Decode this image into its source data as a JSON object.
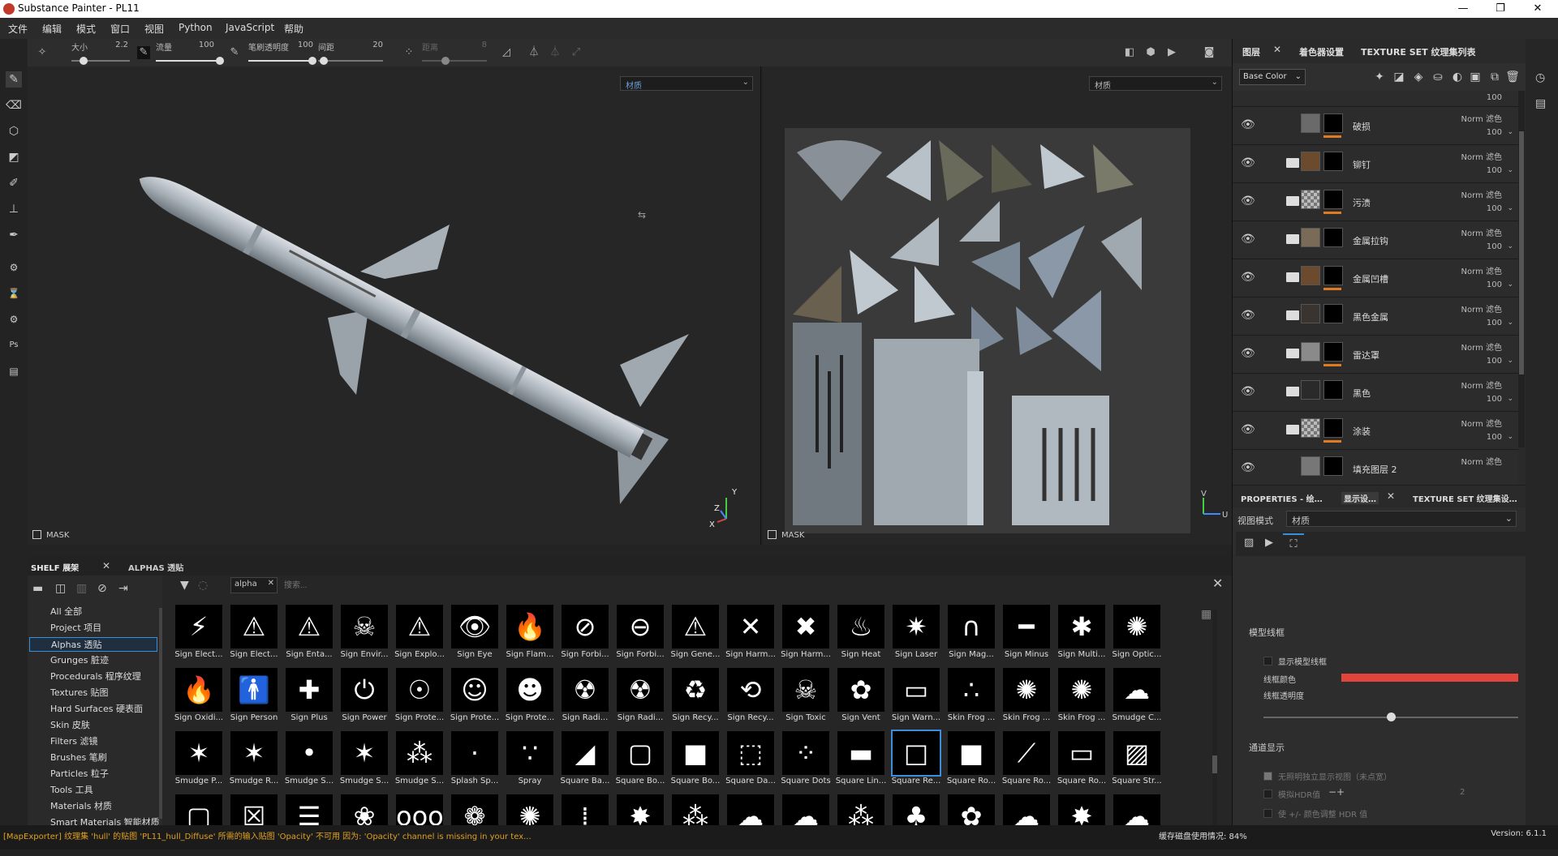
{
  "window": {
    "title": "Substance Painter - PL11",
    "minimize": "—",
    "maximize": "❐",
    "close": "✕"
  },
  "menu": [
    "文件",
    "编辑",
    "模式",
    "窗口",
    "视图",
    "Python",
    "JavaScript",
    "帮助"
  ],
  "toolbar": {
    "size": {
      "label": "大小",
      "value": "2.2"
    },
    "flow": {
      "label": "流量",
      "value": "100"
    },
    "stroke_opacity": {
      "label": "笔刷透明度",
      "value": "100"
    },
    "spacing": {
      "label": "间距",
      "value": "20"
    },
    "jitter": {
      "label": "距离",
      "value": "8"
    }
  },
  "viewport": {
    "left_select": "材质",
    "right_select": "材质",
    "mask_label": "MASK",
    "axes": {
      "y": "Y",
      "z": "Z",
      "x": "X",
      "u": "U",
      "v": "V"
    }
  },
  "layers_panel": {
    "tabs": [
      "图层",
      "着色器设置",
      "TEXTURE SET 纹理集列表"
    ],
    "channel": "Base Color",
    "layers": [
      {
        "name": "破损",
        "blend": "Norm 滤色",
        "opacity": "100",
        "thumb": "#6a6a6a",
        "has_folder": false
      },
      {
        "name": "铆钉",
        "blend": "Norm 滤色",
        "opacity": "100",
        "thumb": "#6b4a2e",
        "has_folder": true
      },
      {
        "name": "污渍",
        "blend": "Norm 滤色",
        "opacity": "100",
        "thumb": "checker",
        "has_folder": true
      },
      {
        "name": "金属拉钩",
        "blend": "Norm 滤色",
        "opacity": "100",
        "thumb": "#7a6a58",
        "has_folder": true
      },
      {
        "name": "金属凹槽",
        "blend": "Norm 滤色",
        "opacity": "100",
        "thumb": "#6b4a2e",
        "has_folder": true
      },
      {
        "name": "黑色金属",
        "blend": "Norm 滤色",
        "opacity": "100",
        "thumb": "#3a3430",
        "has_folder": true
      },
      {
        "name": "雷达罩",
        "blend": "Norm 滤色",
        "opacity": "100",
        "thumb": "#8a8a8a",
        "has_folder": true
      },
      {
        "name": "黑色",
        "blend": "Norm 滤色",
        "opacity": "100",
        "thumb": "#2a2a2a",
        "has_folder": true
      },
      {
        "name": "涂装",
        "blend": "Norm 滤色",
        "opacity": "100",
        "thumb": "checker",
        "has_folder": true
      },
      {
        "name": "填充图层 2",
        "blend": "Norm 滤色",
        "opacity": "",
        "thumb": "#777777",
        "has_folder": false
      }
    ]
  },
  "properties": {
    "tabs": [
      "PROPERTIES - 绘…",
      "显示设…",
      "TEXTURE SET 纹理集设…"
    ],
    "view_mode_label": "视图模式",
    "view_mode_value": "材质",
    "wireframe_section": "模型线框",
    "show_wireframe": "显示模型线框",
    "wire_color_label": "线框颜色",
    "wire_color": "#e0443a",
    "wire_opacity_label": "线框透明度",
    "wire_opacity": 0.5,
    "channel_section": "通道显示",
    "isolate": "无照明独立显示视图（未点宽）",
    "hdr_label": "模拟HDR值",
    "hdr_value": "2",
    "hdr_adjust": "使 +/- 颜色调整 HDR 值"
  },
  "shelf": {
    "tabs": [
      "SHELF 展架",
      "ALPHAS 透贴"
    ],
    "filter_tag": "alpha",
    "search_placeholder": "搜索...",
    "categories": [
      "All 全部",
      "Project 项目",
      "Alphas 透贴",
      "Grunges 脏迹",
      "Procedurals 程序纹理",
      "Textures 贴图",
      "Hard Surfaces 硬表面",
      "Skin 皮肤",
      "Filters 滤镜",
      "Brushes 笔刷",
      "Particles 粒子",
      "Tools 工具",
      "Materials 材质",
      "Smart Materials 智能材质"
    ],
    "selected_category": "Alphas 透贴",
    "alphas": [
      {
        "label": "Sign Elect...",
        "glyph": "⚡"
      },
      {
        "label": "Sign Elect...",
        "glyph": "⚠"
      },
      {
        "label": "Sign Enta...",
        "glyph": "⚠"
      },
      {
        "label": "Sign Envir...",
        "glyph": "☠"
      },
      {
        "label": "Sign Explo...",
        "glyph": "⚠"
      },
      {
        "label": "Sign Eye",
        "glyph": "👁"
      },
      {
        "label": "Sign Flam...",
        "glyph": "🔥"
      },
      {
        "label": "Sign Forbi...",
        "glyph": "⊘"
      },
      {
        "label": "Sign Forbi...",
        "glyph": "⊖"
      },
      {
        "label": "Sign Gene...",
        "glyph": "⚠"
      },
      {
        "label": "Sign Harm...",
        "glyph": "✕"
      },
      {
        "label": "Sign Harm...",
        "glyph": "✖"
      },
      {
        "label": "Sign Heat",
        "glyph": "♨"
      },
      {
        "label": "Sign Laser",
        "glyph": "✷"
      },
      {
        "label": "Sign Mag...",
        "glyph": "∩"
      },
      {
        "label": "Sign Minus",
        "glyph": "━"
      },
      {
        "label": "Sign Multi...",
        "glyph": "✱"
      },
      {
        "label": "Sign Optic...",
        "glyph": "✺"
      },
      {
        "label": "Sign Oxidi...",
        "glyph": "🔥"
      },
      {
        "label": "Sign Person",
        "glyph": "🚹"
      },
      {
        "label": "Sign Plus",
        "glyph": "✚"
      },
      {
        "label": "Sign Power",
        "glyph": "⏻"
      },
      {
        "label": "Sign Prote...",
        "glyph": "☉"
      },
      {
        "label": "Sign Prote...",
        "glyph": "☺"
      },
      {
        "label": "Sign Prote...",
        "glyph": "☻"
      },
      {
        "label": "Sign Radi...",
        "glyph": "☢"
      },
      {
        "label": "Sign Radi...",
        "glyph": "☢"
      },
      {
        "label": "Sign Recy...",
        "glyph": "♻"
      },
      {
        "label": "Sign Recy...",
        "glyph": "⟲"
      },
      {
        "label": "Sign Toxic",
        "glyph": "☠"
      },
      {
        "label": "Sign Vent",
        "glyph": "✿"
      },
      {
        "label": "Sign Warn...",
        "glyph": "▭"
      },
      {
        "label": "Skin Frog ...",
        "glyph": "∴"
      },
      {
        "label": "Skin Frog ...",
        "glyph": "✺"
      },
      {
        "label": "Skin Frog ...",
        "glyph": "✺"
      },
      {
        "label": "Smudge C...",
        "glyph": "☁"
      },
      {
        "label": "Smudge P...",
        "glyph": "✶"
      },
      {
        "label": "Smudge R...",
        "glyph": "✶"
      },
      {
        "label": "Smudge S...",
        "glyph": "•"
      },
      {
        "label": "Smudge S...",
        "glyph": "✶"
      },
      {
        "label": "Smudge S...",
        "glyph": "⁂"
      },
      {
        "label": "Splash Sp...",
        "glyph": "·"
      },
      {
        "label": "Spray",
        "glyph": "∵"
      },
      {
        "label": "Square Ba...",
        "glyph": "◢"
      },
      {
        "label": "Square Bo...",
        "glyph": "▢"
      },
      {
        "label": "Square Bo...",
        "glyph": "■"
      },
      {
        "label": "Square Da...",
        "glyph": "⬚"
      },
      {
        "label": "Square Dots",
        "glyph": "⁘"
      },
      {
        "label": "Square Lin...",
        "glyph": "▬"
      },
      {
        "label": "Square Re...",
        "glyph": "□"
      },
      {
        "label": "Square Ro...",
        "glyph": "■"
      },
      {
        "label": "Square Ro...",
        "glyph": "⟋"
      },
      {
        "label": "Square Ro...",
        "glyph": "▭"
      },
      {
        "label": "Square Str...",
        "glyph": "▨"
      },
      {
        "label": "",
        "glyph": "▢"
      },
      {
        "label": "",
        "glyph": "☒"
      },
      {
        "label": "",
        "glyph": "☰"
      },
      {
        "label": "",
        "glyph": "❀"
      },
      {
        "label": "",
        "glyph": "ooo"
      },
      {
        "label": "",
        "glyph": "❁"
      },
      {
        "label": "",
        "glyph": "✺"
      },
      {
        "label": "",
        "glyph": "⁞"
      },
      {
        "label": "",
        "glyph": "✸"
      },
      {
        "label": "",
        "glyph": "⁂"
      },
      {
        "label": "",
        "glyph": "☁"
      },
      {
        "label": "",
        "glyph": "☁"
      },
      {
        "label": "",
        "glyph": "⁂"
      },
      {
        "label": "",
        "glyph": "♣"
      },
      {
        "label": "",
        "glyph": "✿"
      },
      {
        "label": "",
        "glyph": "☁"
      },
      {
        "label": "",
        "glyph": "✸"
      },
      {
        "label": "",
        "glyph": "☁"
      }
    ]
  },
  "status": {
    "message": "[MapExporter] 纹理集 'hull' 的贴图 'PL11_hull_Diffuse' 所需的输入贴图 'Opacity' 不可用 因为: 'Opacity' channel is missing in your tex...",
    "memory": "缓存磁盘使用情况:  84%",
    "version": "Version: 6.1.1"
  }
}
